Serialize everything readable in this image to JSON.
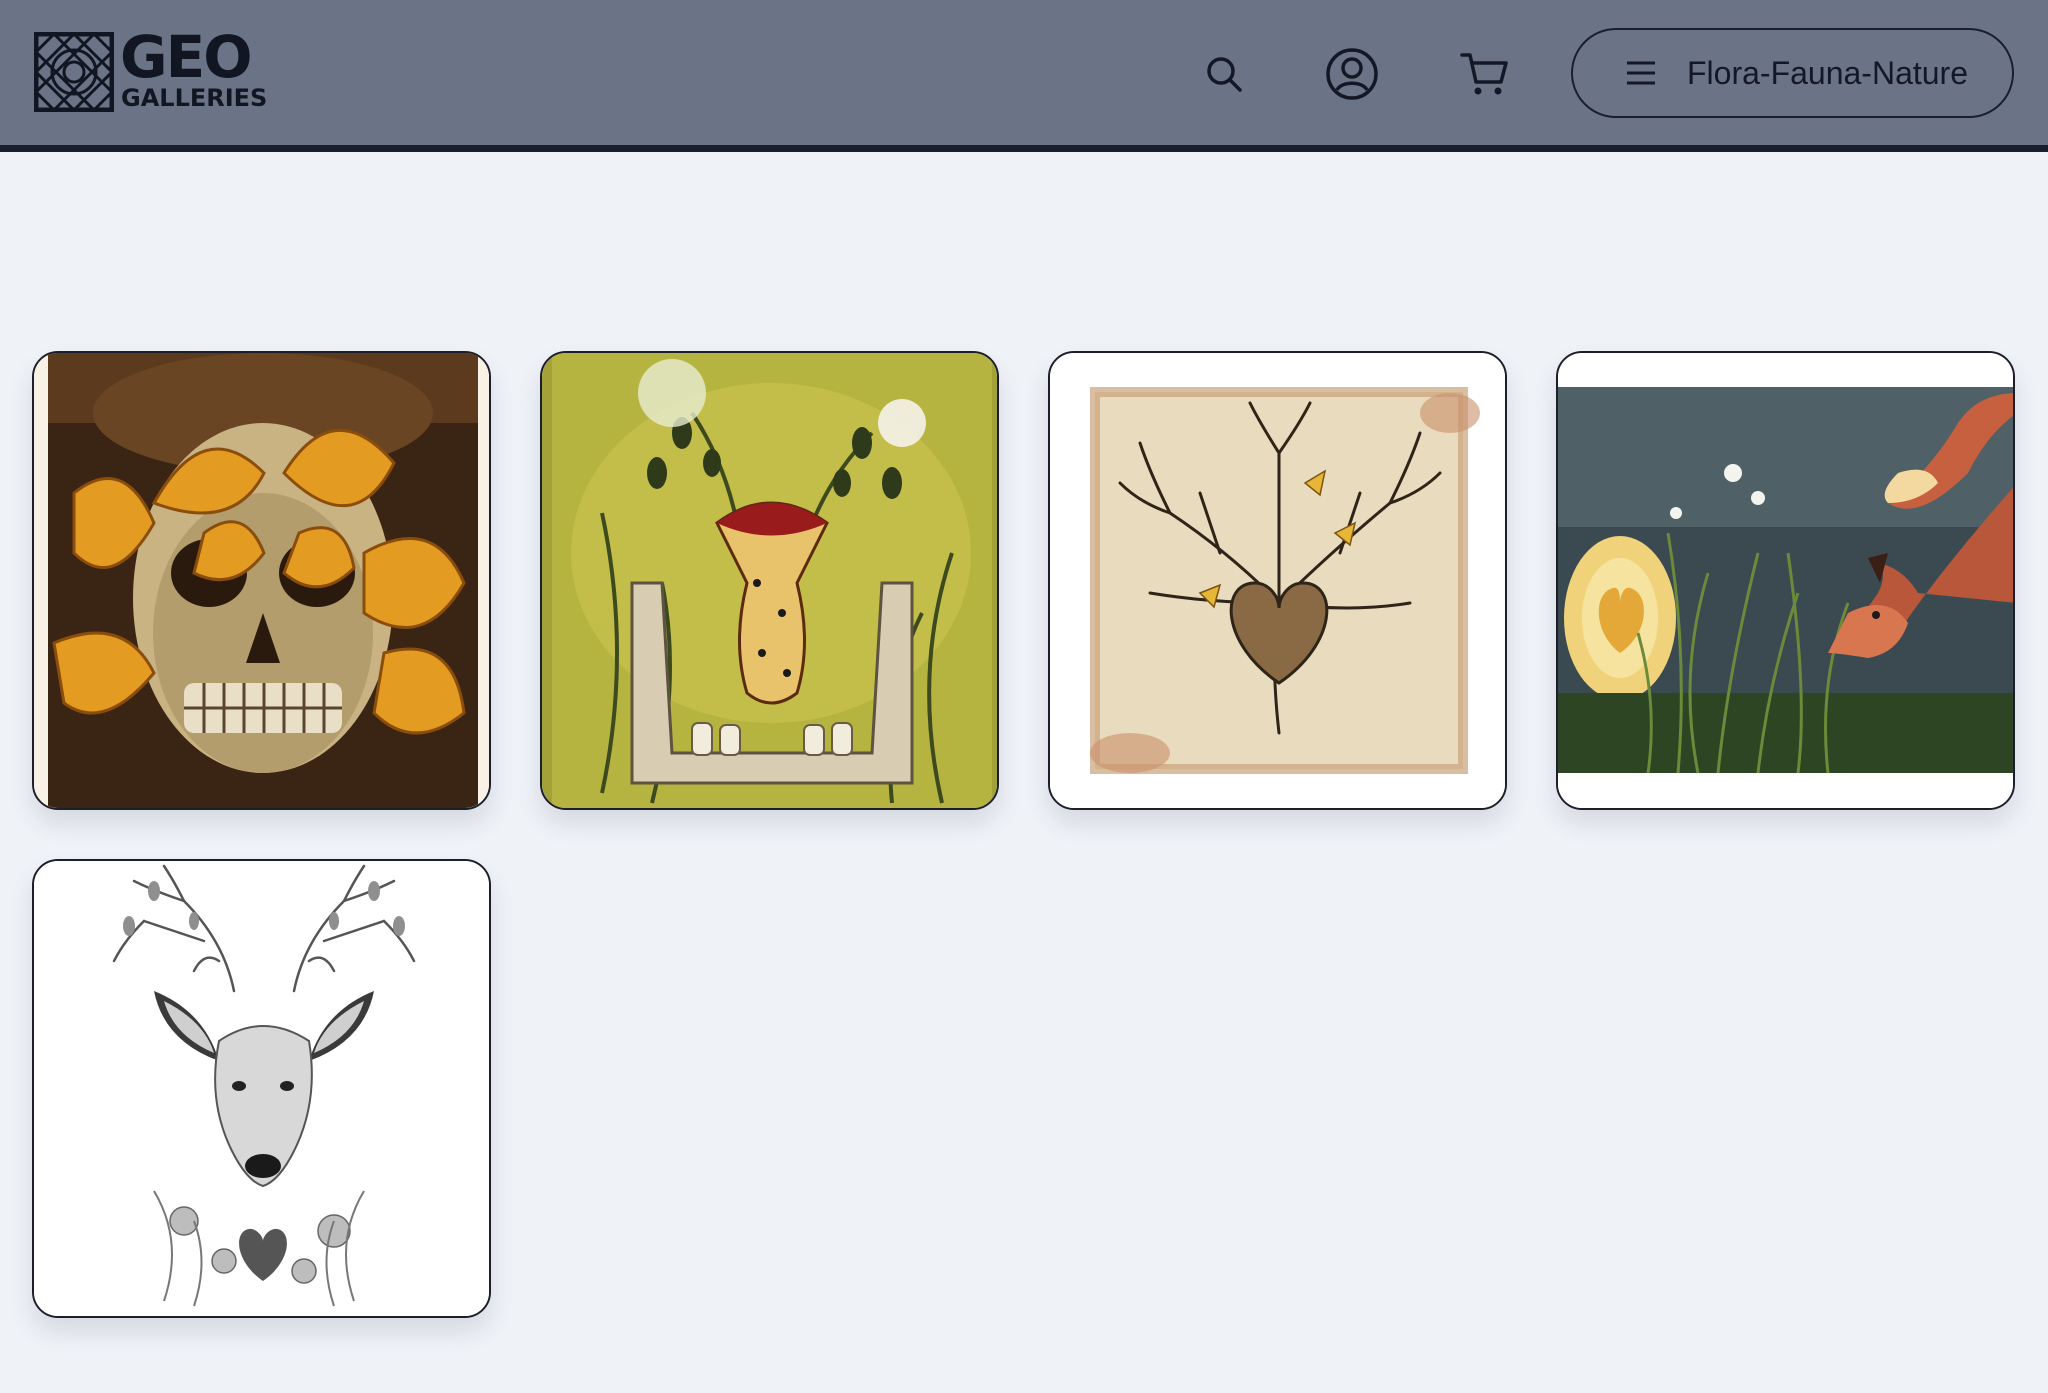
{
  "header": {
    "logo": {
      "line1": "GEO",
      "line2": "GALLERIES"
    },
    "menu_label": "Flora-Fauna-Nature",
    "icons": [
      "search-icon",
      "account-icon",
      "cart-icon",
      "hamburger-icon"
    ]
  },
  "colors": {
    "header_bg": "#6a7486",
    "header_border": "#1a1e2e",
    "page_bg": "#eff2f7",
    "tile_bg": "#ffffff"
  },
  "gallery": {
    "items": [
      {
        "subject": "ginkgo-skull-artwork"
      },
      {
        "subject": "apple-core-jaw-artwork"
      },
      {
        "subject": "tree-heart-artwork"
      },
      {
        "subject": "fox-heart-artwork"
      },
      {
        "subject": "deer-branches-artwork"
      }
    ]
  }
}
